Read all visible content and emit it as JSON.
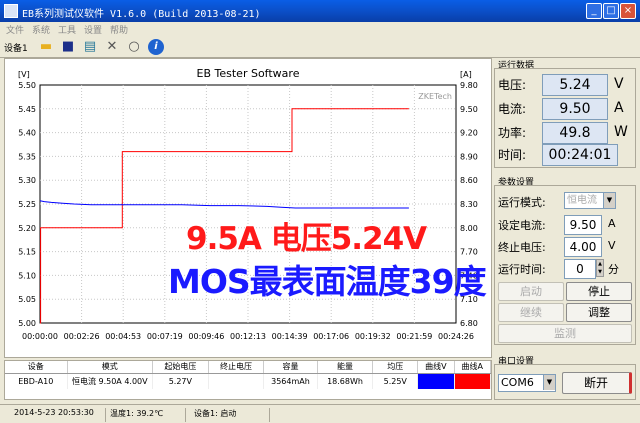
{
  "window": {
    "title": "EB系列测试仪软件 V1.6.0 (Build 2013-08-21)",
    "controls": [
      "_",
      "□",
      "×"
    ]
  },
  "menu": [
    "文件",
    "系统",
    "工具",
    "设置",
    "帮助"
  ],
  "toolbar": {
    "device_tab": "设备1",
    "icons": [
      "folder-icon",
      "save-icon",
      "chart-icon",
      "tools-icon",
      "search-icon",
      "info-icon"
    ]
  },
  "chart_data": {
    "type": "line",
    "title": "EB Tester Software",
    "watermark": "ZKETech",
    "y_left_unit": "[V]",
    "y_right_unit": "[A]",
    "y_left_lim": [
      5.0,
      5.5
    ],
    "y_right_lim": [
      6.8,
      9.8
    ],
    "y_left_ticks": [
      "5.50",
      "5.45",
      "5.40",
      "5.35",
      "5.30",
      "5.25",
      "5.20",
      "5.15",
      "5.10",
      "5.05",
      "5.00"
    ],
    "y_right_ticks": [
      "9.80",
      "9.50",
      "9.20",
      "8.90",
      "8.60",
      "8.30",
      "8.00",
      "7.70",
      "7.40",
      "7.10",
      "6.80"
    ],
    "x_ticks": [
      "00:00:00",
      "00:02:26",
      "00:04:53",
      "00:07:19",
      "00:09:46",
      "00:12:13",
      "00:14:39",
      "00:17:06",
      "00:19:32",
      "00:21:59",
      "00:24:26"
    ],
    "x_lim_seconds": [
      0,
      1466
    ],
    "grid": true,
    "series": [
      {
        "axis": "left",
        "color": "#ff0000",
        "x": [
          0,
          2,
          2,
          290,
          290,
          888,
          888,
          1300
        ],
        "y": [
          5.0,
          5.0,
          5.2,
          5.2,
          5.36,
          5.36,
          5.45,
          5.45
        ]
      },
      {
        "axis": "right",
        "color": "#0000ff",
        "x": [
          0,
          15,
          40,
          80,
          120,
          180,
          240,
          300,
          400,
          500,
          600,
          700,
          800,
          850,
          900,
          1000,
          1100,
          1200,
          1300
        ],
        "y": [
          8.34,
          8.33,
          8.32,
          8.31,
          8.3,
          8.29,
          8.29,
          8.29,
          8.29,
          8.29,
          8.28,
          8.28,
          8.27,
          8.26,
          8.25,
          8.25,
          8.25,
          8.25,
          8.25
        ]
      }
    ]
  },
  "overlay": {
    "line1": "9.5A  电压5.24V",
    "line2": "MOS最表面温度39度"
  },
  "data_table": {
    "headers": [
      "设备",
      "模式",
      "起始电压",
      "终止电压",
      "容量",
      "能量",
      "均压",
      "曲线V",
      "曲线A"
    ],
    "rows": [
      [
        "EBD-A10",
        "恒电流 9.50A 4.00V",
        "5.27V",
        "",
        "3564mAh",
        "18.68Wh",
        "5.25V",
        "",
        ""
      ]
    ]
  },
  "status": {
    "datetime": "2014-5-23 20:53:30",
    "temperature": "温度1: 39.2℃",
    "device_state": "设备1: 启动"
  },
  "runtime": {
    "title": "运行数据",
    "voltage_label": "电压:",
    "voltage": "5.24",
    "voltage_unit": "V",
    "current_label": "电流:",
    "current": "9.50",
    "current_unit": "A",
    "power_label": "功率:",
    "power": "49.8",
    "power_unit": "W",
    "time_label": "时间:",
    "time": "00:24:01"
  },
  "params": {
    "title": "参数设置",
    "mode_label": "运行模式:",
    "mode": "恒电流",
    "set_current_label": "设定电流:",
    "set_current": "9.50",
    "set_current_unit": "A",
    "end_voltage_label": "终止电压:",
    "end_voltage": "4.00",
    "end_voltage_unit": "V",
    "run_time_label": "运行时间:",
    "run_time": "0",
    "run_time_unit": "分",
    "buttons": {
      "start": "启动",
      "stop": "停止",
      "continue": "继续",
      "adjust": "调整",
      "monitor": "监测"
    }
  },
  "serial": {
    "title": "串口设置",
    "port": "COM6",
    "disconnect": "断开"
  },
  "colors": {
    "titlebar": "#0b4fc8",
    "readout_bg": "#dde6f3",
    "red_series": "#ff0000",
    "blue_series": "#0000ff"
  }
}
